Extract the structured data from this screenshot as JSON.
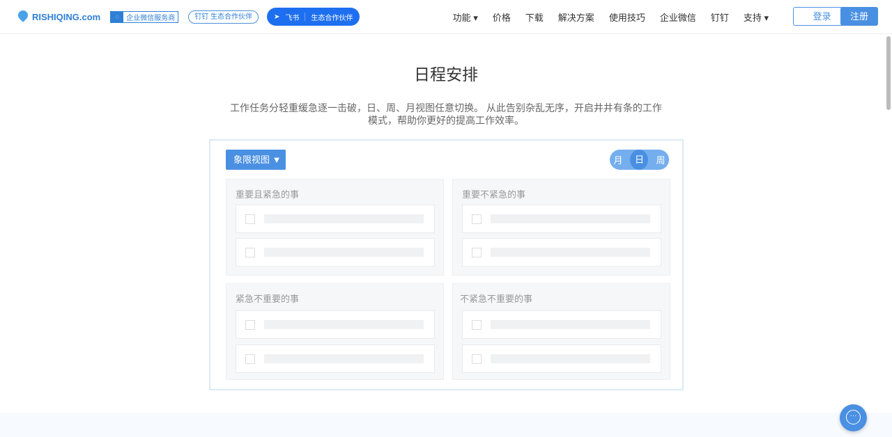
{
  "header": {
    "logo": "RISHIQING.com",
    "badge_wechat": "企业微信服务商",
    "badge_dingtalk": "钉钉 生态合作伙伴",
    "badge_feishu": "飞书",
    "badge_feishu_sub": "生态合作伙伴",
    "nav": [
      "功能 ▾",
      "价格",
      "下载",
      "解决方案",
      "使用技巧",
      "企业微信",
      "钉钉",
      "支持 ▾"
    ],
    "login": "登录",
    "register": "注册"
  },
  "main": {
    "title": "日程安排",
    "description": "工作任务分轻重缓急逐一击破，日、周、月视图任意切换。 从此告别杂乱无序，开启井井有条的工作模式，帮助你更好的提高工作效率。",
    "view_button": "象限视图 ▼",
    "segments": [
      "月",
      "日",
      "周"
    ],
    "active_segment": "日",
    "quadrants": [
      "重要且紧急的事",
      "重要不紧急的事",
      "紧急不重要的事",
      "不紧急不重要的事"
    ]
  }
}
